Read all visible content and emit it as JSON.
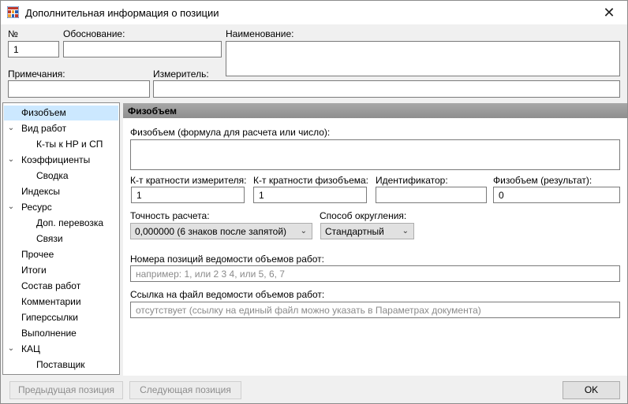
{
  "window": {
    "title": "Дополнительная информация о позиции",
    "app_icon": "table-grid-icon",
    "close_glyph": "✕"
  },
  "header": {
    "number_label": "№",
    "number_value": "1",
    "basis_label": "Обоснование:",
    "basis_value": "",
    "name_label": "Наименование:",
    "name_value": "",
    "notes_label": "Примечания:",
    "notes_value": "",
    "unit_label": "Измеритель:",
    "unit_value": ""
  },
  "tree": {
    "items": [
      {
        "label": "Физобъем",
        "selected": true
      },
      {
        "label": "Вид работ",
        "expandable": true
      },
      {
        "label": "К-ты к НР и СП"
      },
      {
        "label": "Коэффициенты",
        "expandable": true
      },
      {
        "label": "Сводка"
      },
      {
        "label": "Индексы"
      },
      {
        "label": "Ресурс",
        "expandable": true
      },
      {
        "label": "Доп. перевозка"
      },
      {
        "label": "Связи"
      },
      {
        "label": "Прочее"
      },
      {
        "label": "Итоги"
      },
      {
        "label": "Состав работ"
      },
      {
        "label": "Комментарии"
      },
      {
        "label": "Гиперссылки"
      },
      {
        "label": "Выполнение"
      },
      {
        "label": "КАЦ",
        "expandable": true
      },
      {
        "label": "Поставщик"
      }
    ]
  },
  "panel": {
    "title": "Физобъем",
    "formula_label": "Физобъем (формула для расчета или число):",
    "formula_value": "",
    "unit_multiplicity_label": "К-т кратности измерителя:",
    "unit_multiplicity_value": "1",
    "volume_multiplicity_label": "К-т кратности физобъема:",
    "volume_multiplicity_value": "1",
    "identifier_label": "Идентификатор:",
    "identifier_value": "",
    "result_label": "Физобъем (результат):",
    "result_value": "0",
    "precision_label": "Точность расчета:",
    "precision_value": "0,000000 (6 знаков после запятой)",
    "rounding_label": "Способ округления:",
    "rounding_value": "Стандартный",
    "position_numbers_label": "Номера позиций ведомости объемов работ:",
    "position_numbers_placeholder": "например: 1, или 2 3 4, или 5, 6, 7",
    "file_link_label": "Ссылка на файл ведомости объемов работ:",
    "file_link_placeholder": "отсутствует (ссылку на единый файл можно указать в Параметрах документа)"
  },
  "footer": {
    "prev_label": "Предыдущая позиция",
    "next_label": "Следующая позиция",
    "ok_label": "OK"
  },
  "colors": {
    "selection": "#cce8ff",
    "header_gray": "#9a9a9a",
    "icon_red": "#c0392b",
    "icon_blue": "#2a5db0"
  }
}
